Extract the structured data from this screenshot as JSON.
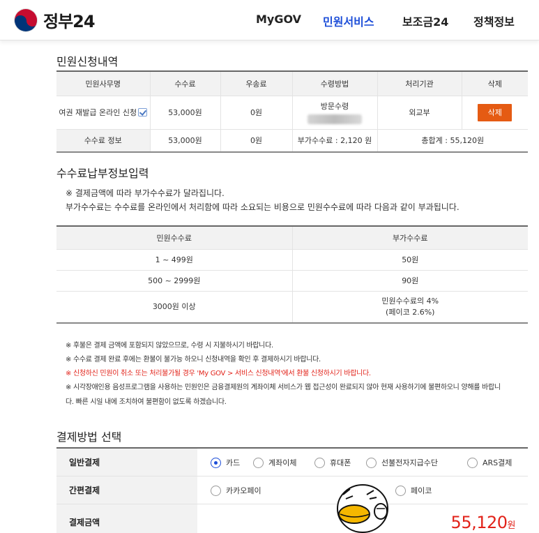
{
  "header": {
    "logo_text": "정부24",
    "nav": [
      "MyGOV",
      "민원서비스",
      "보조금24",
      "정책정보"
    ],
    "active_nav": "민원서비스"
  },
  "apply": {
    "title": "민원신청내역",
    "headers": [
      "민원사무명",
      "수수료",
      "우송료",
      "수령방법",
      "처리기관",
      "삭제"
    ],
    "row": {
      "name": "여권 재발급 온라인 신청",
      "fee": "53,000원",
      "postage": "0원",
      "receive": "방문수령",
      "agency": "외교부",
      "delete_label": "삭제"
    },
    "summary": {
      "label": "수수료 정보",
      "fee": "53,000원",
      "postage": "0원",
      "extra": "부가수수료 : 2,120 원",
      "total": "총합계 : 55,120원"
    }
  },
  "surcharge": {
    "title": "수수료납부정보입력",
    "note1": "※ 결제금액에 따라 부가수수료가 달라집니다.",
    "note2": "부가수수료는 수수료를 온라인에서 처리함에 따라 소요되는 비용으로 민원수수료에 따라 다음과 같이 부과됩니다.",
    "headers": [
      "민원수수료",
      "부가수수료"
    ],
    "rows": [
      {
        "range": "1 ~ 499원",
        "fee": "50원"
      },
      {
        "range": "500 ~ 2999원",
        "fee": "90원"
      },
      {
        "range": "3000원 이상",
        "fee": "민원수수료의 4%",
        "fee2": "(페이코 2.6%)"
      }
    ],
    "notices": [
      "※ 후불은 결제 금액에 포함되지 않았으므로, 수령 시 지불하시기 바랍니다.",
      "※ 수수료 결제 완료 후에는 환불이 불가능 하오니 신청내역을 확인 후 결제하시기 바랍니다.",
      "※ 신청하신 민원이 취소 또는 처리불가될 경우 'My GOV > 서비스 신청내역'에서 환불 신청하시기 바랍니다.",
      "※ 시각장애인용 음성프로그램을 사용하는 민원인은 금융결제원의 계좌이체 서비스가 웹 접근성이 완료되지 않아 현재 사용하기에 불편하오니 양해를 바랍니",
      "다. 빠른 시일 내에 조치하여 불편함이 없도록 하겠습니다."
    ]
  },
  "payment": {
    "title": "결제방법 선택",
    "general_label": "일반결제",
    "general_options": [
      "카드",
      "계좌이체",
      "휴대폰",
      "선불전자지급수단",
      "ARS결제"
    ],
    "selected": "카드",
    "simple_label": "간편결제",
    "simple_options": [
      "카카오페이",
      "페이코"
    ],
    "amount_label": "결제금액",
    "amount": "55,120",
    "amount_unit": "원"
  },
  "colors": {
    "accent_blue": "#1d4ed8",
    "delete_orange": "#e55b13",
    "amount_red": "#e2231a"
  }
}
